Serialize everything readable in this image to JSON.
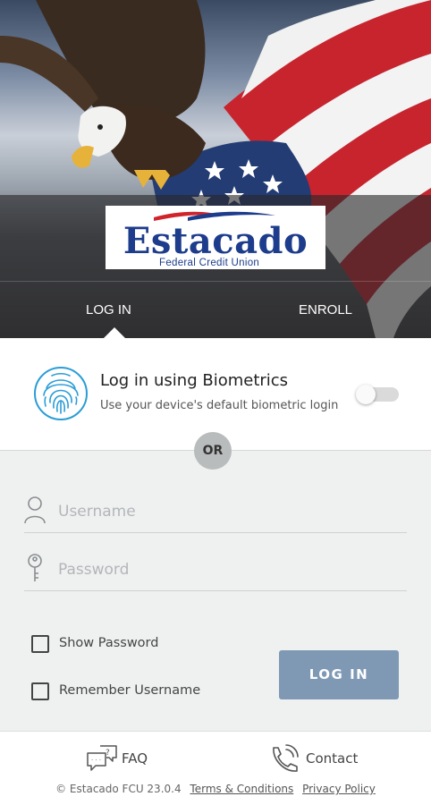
{
  "header": {
    "logo": {
      "name": "Estacado",
      "subtitle": "Federal Credit Union"
    },
    "tabs": [
      {
        "label": "LOG IN",
        "active": true
      },
      {
        "label": "ENROLL",
        "active": false
      }
    ]
  },
  "biometrics": {
    "icon": "fingerprint-icon",
    "title": "Log in using Biometrics",
    "subtitle": "Use your device's default biometric login",
    "enabled": false
  },
  "divider_label": "OR",
  "form": {
    "username": {
      "icon": "user-icon",
      "placeholder": "Username",
      "value": ""
    },
    "password": {
      "icon": "key-icon",
      "placeholder": "Password",
      "value": ""
    },
    "show_password": {
      "label": "Show Password",
      "checked": false
    },
    "remember_username": {
      "label": "Remember Username",
      "checked": false
    },
    "submit_label": "LOG IN"
  },
  "footer": {
    "faq": {
      "icon": "chat-faq-icon",
      "label": "FAQ"
    },
    "contact": {
      "icon": "phone-icon",
      "label": "Contact"
    },
    "copyright": "© Estacado FCU 23.0.4",
    "terms_link": "Terms & Conditions",
    "privacy_link": "Privacy Policy"
  },
  "colors": {
    "brand_blue": "#1d3c8b",
    "brand_red": "#d0242c",
    "button": "#7f99b5",
    "form_bg": "#eff1f1"
  }
}
